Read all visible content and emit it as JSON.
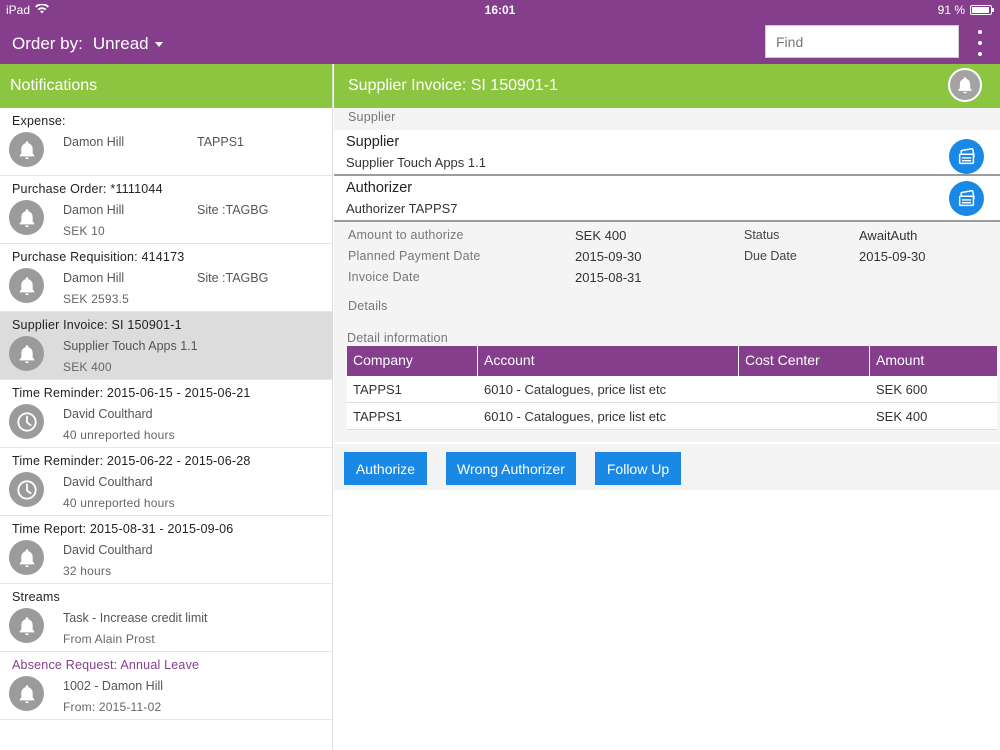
{
  "status_bar": {
    "device": "iPad",
    "time": "16:01",
    "battery": "91 %"
  },
  "header": {
    "order_by_label": "Order by:",
    "order_by_value": "Unread",
    "search_placeholder": "Find"
  },
  "notifications": {
    "title": "Notifications",
    "items": [
      {
        "title": "Expense:",
        "line1": "Damon Hill",
        "line2": "",
        "right": "TAPPS1",
        "icon": "bell-icon",
        "selected": false
      },
      {
        "title": "Purchase Order: *1111044",
        "line1": "Damon Hill",
        "line2": "SEK 10",
        "right": "Site :TAGBG",
        "icon": "bell-icon",
        "selected": false
      },
      {
        "title": "Purchase Requisition: 414173",
        "line1": "Damon Hill",
        "line2": "SEK 2593.5",
        "right": "Site :TAGBG",
        "icon": "bell-icon",
        "selected": false
      },
      {
        "title": "Supplier Invoice: SI 150901-1",
        "line1": "Supplier Touch Apps 1.1",
        "line2": "SEK 400",
        "right": "",
        "icon": "bell-icon",
        "selected": true
      },
      {
        "title": "Time Reminder: 2015-06-15 - 2015-06-21",
        "line1": "David Coulthard",
        "line2": "40 unreported hours",
        "right": "",
        "icon": "clock-icon",
        "selected": false
      },
      {
        "title": "Time Reminder: 2015-06-22 - 2015-06-28",
        "line1": "David Coulthard",
        "line2": "40 unreported hours",
        "right": "",
        "icon": "clock-icon",
        "selected": false
      },
      {
        "title": "Time Report: 2015-08-31 - 2015-09-06",
        "line1": "David Coulthard",
        "line2": "32 hours",
        "right": "",
        "icon": "bell-icon",
        "selected": false
      },
      {
        "title": "Streams",
        "line1": "Task - Increase credit limit",
        "line2": "From Alain Prost",
        "right": "",
        "icon": "bell-icon",
        "selected": false
      },
      {
        "title": "Absence Request: Annual Leave",
        "line1": "1002 - Damon Hill",
        "line2": "From: 2015-11-02",
        "right": "",
        "icon": "bell-icon",
        "selected": false,
        "title_color": "purple"
      }
    ]
  },
  "detail": {
    "title": "Supplier Invoice: SI 150901-1",
    "section_supplier": "Supplier",
    "supplier_label": "Supplier",
    "supplier_value": "Supplier Touch Apps 1.1",
    "authorizer_label": "Authorizer",
    "authorizer_value": "Authorizer TAPPS7",
    "fields": {
      "amount_label": "Amount to authorize",
      "amount_value": "SEK 400",
      "planned_label": "Planned Payment Date",
      "planned_value": "2015-09-30",
      "invoice_label": "Invoice Date",
      "invoice_value": "2015-08-31",
      "status_label": "Status",
      "status_value": "AwaitAuth",
      "due_label": "Due Date",
      "due_value": "2015-09-30"
    },
    "details_label": "Details",
    "detail_info_label": "Detail information",
    "table": {
      "headers": [
        "Company",
        "Account",
        "Cost Center",
        "Amount"
      ],
      "rows": [
        [
          "TAPPS1",
          "6010 - Catalogues, price list etc",
          "",
          "SEK 600"
        ],
        [
          "TAPPS1",
          "6010 - Catalogues, price list etc",
          "",
          "SEK 400"
        ]
      ]
    },
    "actions": {
      "authorize": "Authorize",
      "wrong_authorizer": "Wrong Authorizer",
      "follow_up": "Follow Up"
    }
  },
  "colors": {
    "purple": "#843e8c",
    "green": "#8cc53f",
    "blue": "#1a89e6",
    "icon_gray": "#9b9b9b"
  }
}
